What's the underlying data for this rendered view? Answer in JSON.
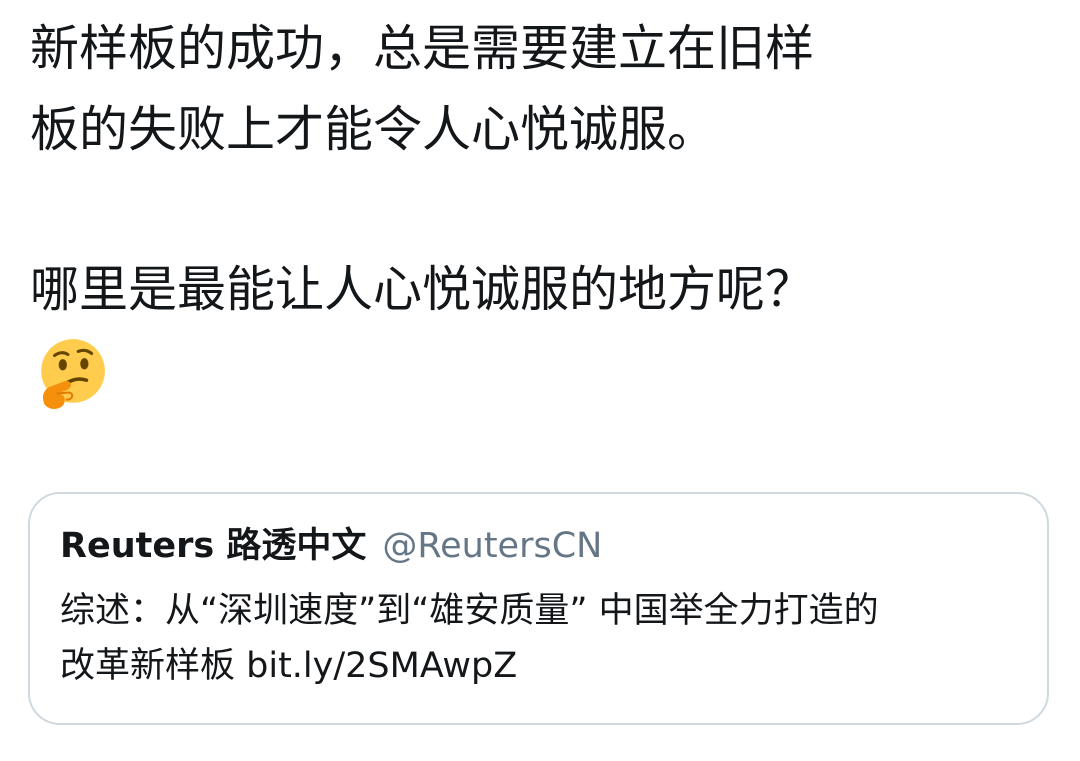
{
  "tweet": {
    "text_lines": [
      "新样板的成功，总是需要建立在旧样",
      "板的失败上才能令人心悦诚服。",
      "",
      "哪里是最能让人心悦诚服的地方呢？"
    ],
    "emoji": "thinking-face-icon"
  },
  "quote": {
    "author_name": "Reuters 路透中文",
    "author_handle": "@ReutersCN",
    "text_lines": [
      "综述：从“深圳速度”到“雄安质量” 中国举全力打造的",
      "改革新样板 bit.ly/2SMAwpZ"
    ]
  },
  "colors": {
    "text": "#14171a",
    "secondary_text": "#657786",
    "card_border": "#cfd9de",
    "background": "#ffffff"
  }
}
